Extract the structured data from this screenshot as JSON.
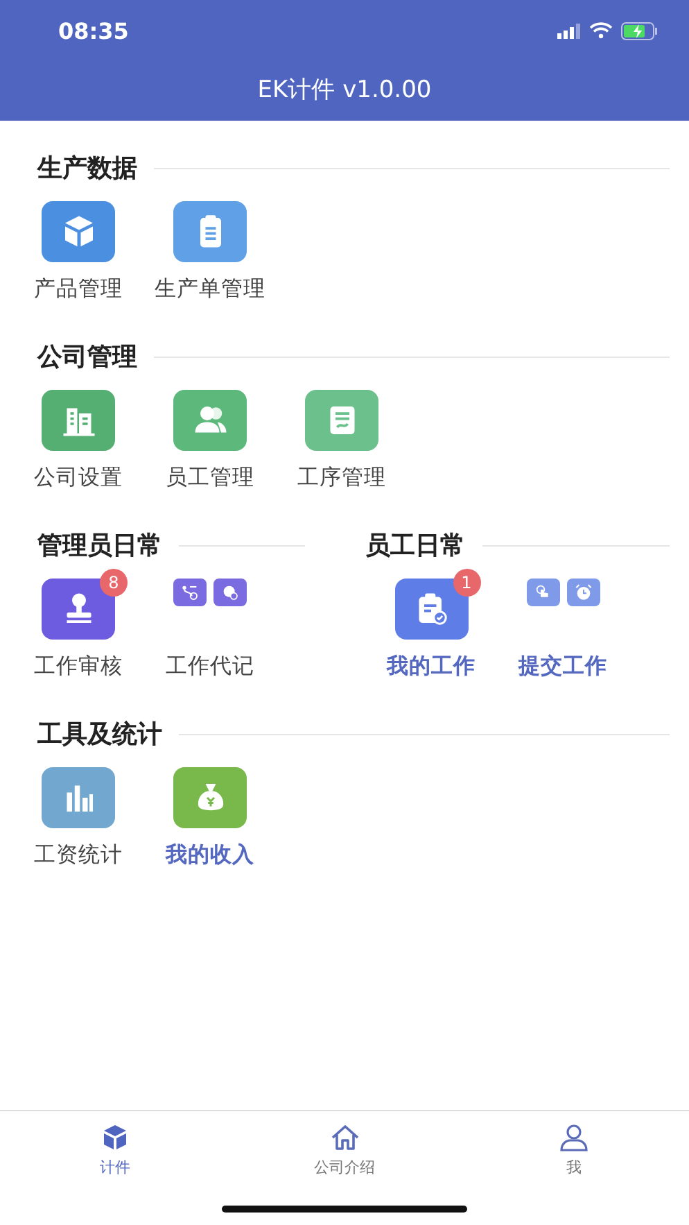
{
  "status_bar": {
    "time": "08:35"
  },
  "header": {
    "title": "EK计件 v1.0.00"
  },
  "rows": [
    {
      "sections": [
        {
          "title": "生产数据",
          "items": [
            {
              "label": "产品管理",
              "kind": "tile",
              "color": "#4b8fe0",
              "highlighted": false
            },
            {
              "label": "生产单管理",
              "kind": "tile",
              "color": "#5fa0e6",
              "highlighted": false
            }
          ]
        }
      ]
    },
    {
      "sections": [
        {
          "title": "公司管理",
          "items": [
            {
              "label": "公司设置",
              "kind": "tile",
              "color": "#55ae72",
              "highlighted": false
            },
            {
              "label": "员工管理",
              "kind": "tile",
              "color": "#5db87c",
              "highlighted": false
            },
            {
              "label": "工序管理",
              "kind": "tile",
              "color": "#6cc08c",
              "highlighted": false
            }
          ]
        }
      ]
    },
    {
      "sections": [
        {
          "title": "管理员日常",
          "items": [
            {
              "label": "工作审核",
              "kind": "tile",
              "color": "#6d5ce0",
              "badge": "8",
              "highlighted": false
            },
            {
              "label": "工作代记",
              "kind": "pair",
              "color": "#7a6ce0",
              "highlighted": false
            }
          ]
        },
        {
          "title": "员工日常",
          "items": [
            {
              "label": "我的工作",
              "kind": "tile",
              "color": "#5f7de6",
              "badge": "1",
              "highlighted": true
            },
            {
              "label": "提交工作",
              "kind": "pair",
              "color": "#7e9ae8",
              "highlighted": true
            }
          ]
        }
      ]
    },
    {
      "sections": [
        {
          "title": "工具及统计",
          "items": [
            {
              "label": "工资统计",
              "kind": "tile",
              "color": "#72a8cf",
              "highlighted": false
            },
            {
              "label": "我的收入",
              "kind": "tile",
              "color": "#79b84a",
              "highlighted": true
            }
          ]
        }
      ]
    }
  ],
  "tab_bar": [
    {
      "label": "计件",
      "selected": true
    },
    {
      "label": "公司介绍",
      "selected": false
    },
    {
      "label": "我",
      "selected": false
    }
  ]
}
